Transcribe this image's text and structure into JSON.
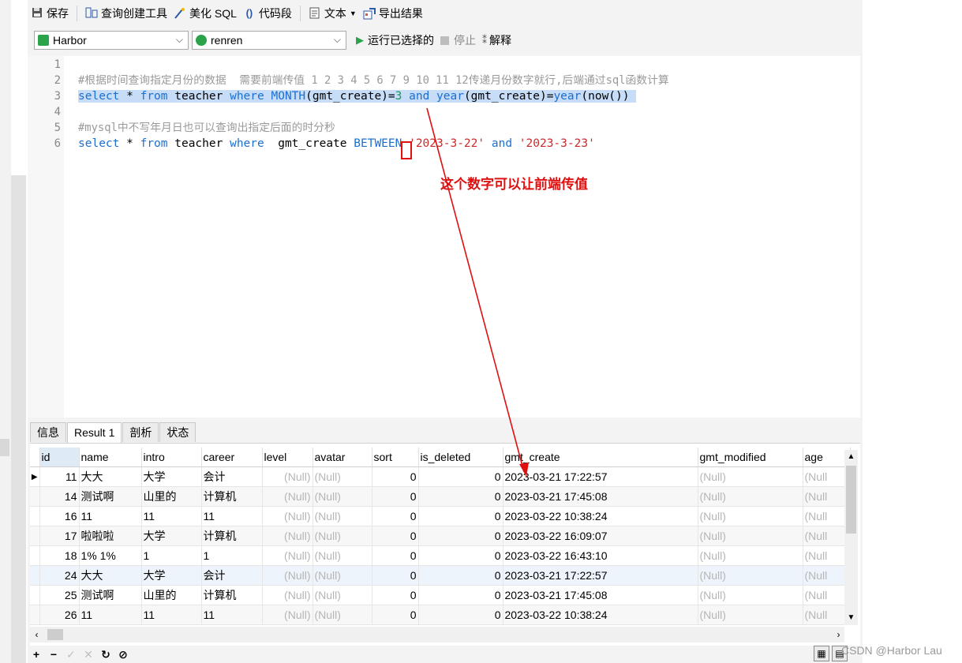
{
  "toolbar": {
    "save": "保存",
    "query_builder": "查询创建工具",
    "beautify": "美化 SQL",
    "snippet": "代码段",
    "text": "文本",
    "export": "导出结果"
  },
  "connection": {
    "value": "Harbor"
  },
  "database": {
    "value": "renren"
  },
  "run": {
    "run_selected": "运行已选择的",
    "stop": "停止",
    "explain": "解释"
  },
  "editor": {
    "line_numbers": [
      "1",
      "2",
      "3",
      "4",
      "5",
      "6"
    ],
    "line2_comment": "#根据时间查询指定月份的数据  需要前端传值 1 2 3 4 5 6 7 9 10 11 12传递月份数字就行,后端通过sql函数计算",
    "line3": {
      "select": "select",
      "star": " * ",
      "from": "from",
      "table": " teacher ",
      "where": "where",
      "sp": " ",
      "month": "MONTH",
      "arg1": "(gmt_create)=",
      "value": "3",
      "and": " and ",
      "year1": "year",
      "arg2": "(gmt_create)=",
      "year2": "year",
      "arg3": "(now())"
    },
    "line5_comment": "#mysql中不写年月日也可以查询出指定后面的时分秒",
    "line6": {
      "select": "select",
      "star": " * ",
      "from": "from",
      "table": " teacher ",
      "where": "where",
      "col": "  gmt_create ",
      "between": "BETWEEN",
      "d1": " '2023-3-22'",
      "and": " and ",
      "d2": "'2023-3-23'"
    }
  },
  "annotation": "这个数字可以让前端传值",
  "tabs": [
    "信息",
    "Result 1",
    "剖析",
    "状态"
  ],
  "grid": {
    "columns": [
      "id",
      "name",
      "intro",
      "career",
      "level",
      "avatar",
      "sort",
      "is_deleted",
      "gmt_create",
      "gmt_modified",
      "age"
    ],
    "rows": [
      [
        "11",
        "大大",
        "大学",
        "会计",
        "(Null)",
        "(Null)",
        "0",
        "0",
        "2023-03-21 17:22:57",
        "(Null)",
        "(Null"
      ],
      [
        "14",
        "测试啊",
        "山里的",
        "计算机",
        "(Null)",
        "(Null)",
        "0",
        "0",
        "2023-03-21 17:45:08",
        "(Null)",
        "(Null"
      ],
      [
        "16",
        "11",
        "11",
        "11",
        "(Null)",
        "(Null)",
        "0",
        "0",
        "2023-03-22 10:38:24",
        "(Null)",
        "(Null"
      ],
      [
        "17",
        "啦啦啦",
        "大学",
        "计算机",
        "(Null)",
        "(Null)",
        "0",
        "0",
        "2023-03-22 16:09:07",
        "(Null)",
        "(Null"
      ],
      [
        "18",
        "1% 1%",
        "1",
        "1",
        "(Null)",
        "(Null)",
        "0",
        "0",
        "2023-03-22 16:43:10",
        "(Null)",
        "(Null"
      ],
      [
        "24",
        "大大",
        "大学",
        "会计",
        "(Null)",
        "(Null)",
        "0",
        "0",
        "2023-03-21 17:22:57",
        "(Null)",
        "(Null"
      ],
      [
        "25",
        "测试啊",
        "山里的",
        "计算机",
        "(Null)",
        "(Null)",
        "0",
        "0",
        "2023-03-21 17:45:08",
        "(Null)",
        "(Null"
      ],
      [
        "26",
        "11",
        "11",
        "11",
        "(Null)",
        "(Null)",
        "0",
        "0",
        "2023-03-22 10:38:24",
        "(Null)",
        "(Null"
      ]
    ]
  },
  "watermark": "CSDN @Harbor Lau",
  "colors": {
    "keyword": "#1c6fd1",
    "string": "#cc2a2a",
    "selection": "#c6dcf7",
    "annotation": "#e01010"
  }
}
